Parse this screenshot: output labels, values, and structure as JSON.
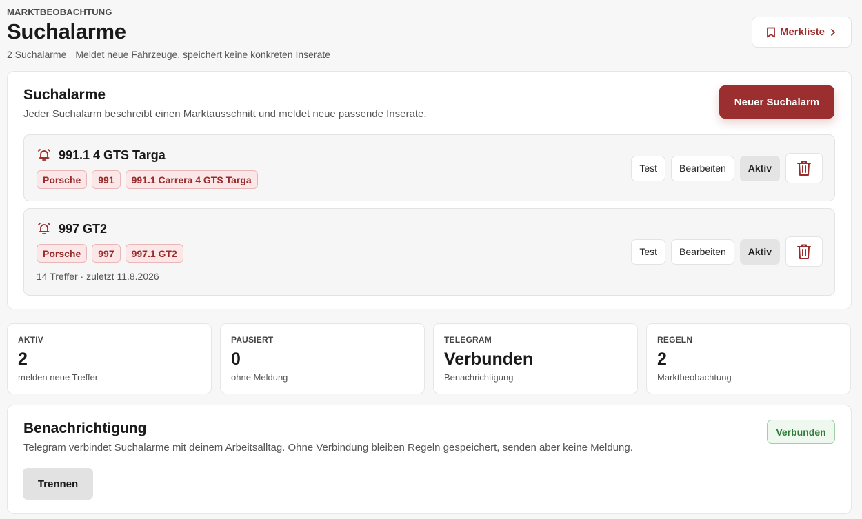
{
  "header": {
    "eyebrow": "MARKTBEOBACHTUNG",
    "title": "Suchalarme",
    "count": "2 Suchalarme",
    "subtitle": "Meldet neue Fahrzeuge, speichert keine konkreten Inserate",
    "merkliste_label": "Merkliste"
  },
  "alarms_section": {
    "title": "Suchalarme",
    "description": "Jeder Suchalarm beschreibt einen Marktausschnitt und meldet neue passende Inserate.",
    "new_button": "Neuer Suchalarm",
    "alarms": [
      {
        "title": "991.1 4 GTS Targa",
        "tags": [
          "Porsche",
          "991",
          "991.1 Carrera 4 GTS Targa"
        ],
        "meta": "",
        "test_label": "Test",
        "edit_label": "Bearbeiten",
        "status_label": "Aktiv"
      },
      {
        "title": "997 GT2",
        "tags": [
          "Porsche",
          "997",
          "997.1 GT2"
        ],
        "meta": "14 Treffer · zuletzt 11.8.2026",
        "test_label": "Test",
        "edit_label": "Bearbeiten",
        "status_label": "Aktiv"
      }
    ]
  },
  "stats": [
    {
      "label": "AKTIV",
      "value": "2",
      "sub": "melden neue Treffer"
    },
    {
      "label": "PAUSIERT",
      "value": "0",
      "sub": "ohne Meldung"
    },
    {
      "label": "TELEGRAM",
      "value": "Verbunden",
      "sub": "Benachrichtigung"
    },
    {
      "label": "REGELN",
      "value": "2",
      "sub": "Marktbeobachtung"
    }
  ],
  "notification": {
    "title": "Benachrichtigung",
    "description": "Telegram verbindet Suchalarme mit deinem Arbeitsalltag. Ohne Verbindung bleiben Regeln gespeichert, senden aber keine Meldung.",
    "badge": "Verbunden",
    "disconnect_label": "Trennen"
  },
  "colors": {
    "accent": "#9b2e2e",
    "success": "#2f7a38"
  }
}
